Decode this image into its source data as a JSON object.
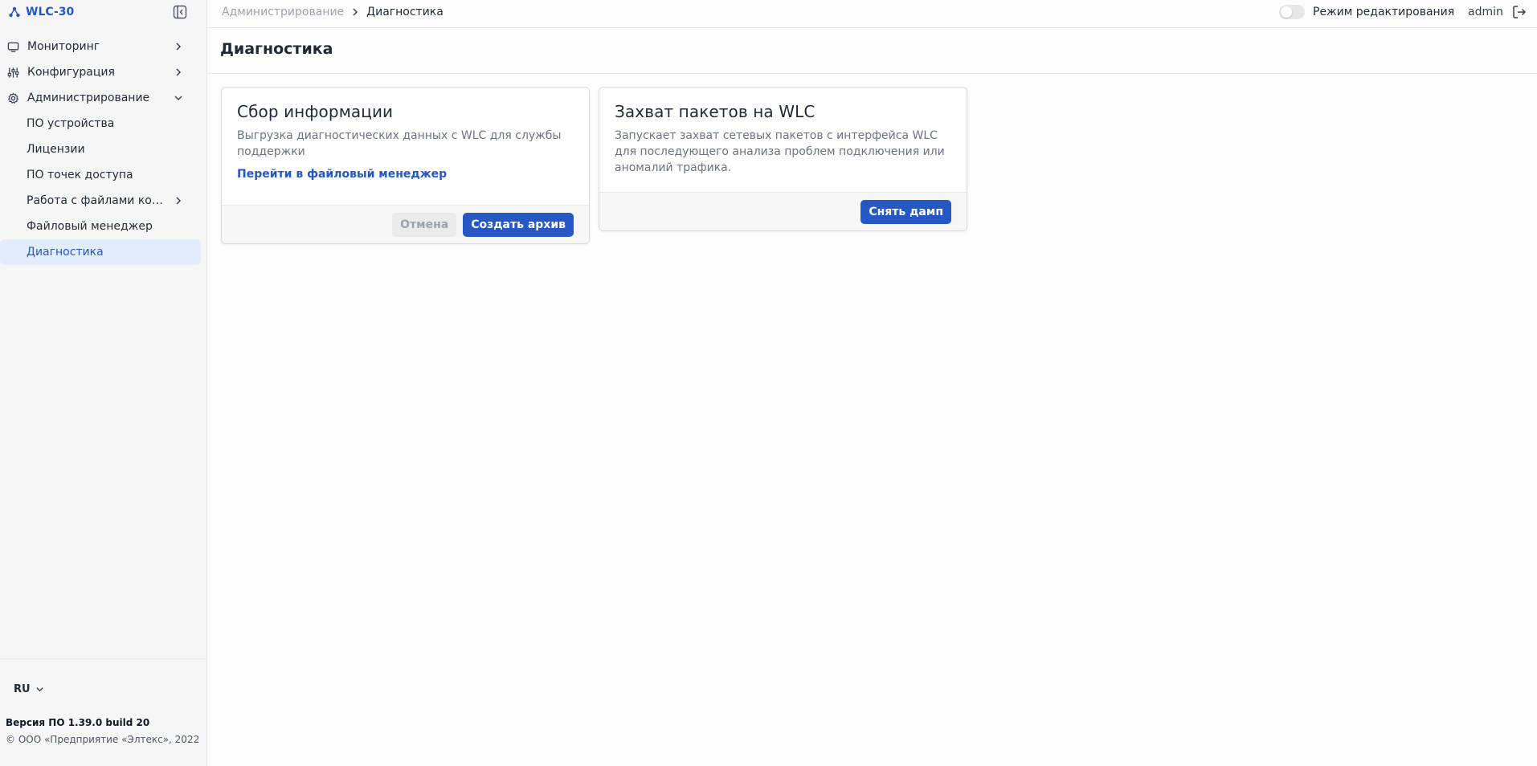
{
  "app": {
    "name": "WLC-30"
  },
  "sidebar": {
    "items": [
      {
        "label": "Мониторинг",
        "icon": "monitor-icon"
      },
      {
        "label": "Конфигурация",
        "icon": "sliders-icon"
      },
      {
        "label": "Администрирование",
        "icon": "gear-icon"
      }
    ],
    "admin_sub": [
      {
        "label": "ПО устройства"
      },
      {
        "label": "Лицензии"
      },
      {
        "label": "ПО точек доступа"
      },
      {
        "label": "Работа с файлами конф..."
      },
      {
        "label": "Файловый менеджер"
      },
      {
        "label": "Диагностика"
      }
    ],
    "language": "RU",
    "version": "Версия ПО 1.39.0 build 20",
    "copyright": "© ООО «Предприятие «Элтекс», 2022"
  },
  "topbar": {
    "breadcrumb_parent": "Администрирование",
    "breadcrumb_current": "Диагностика",
    "edit_mode_label": "Режим редактирования",
    "username": "admin"
  },
  "page": {
    "title": "Диагностика"
  },
  "cards": [
    {
      "title": "Сбор информации",
      "description": "Выгрузка диагностических данных с WLC для службы поддержки",
      "link": "Перейти в файловый менеджер",
      "cancel_label": "Отмена",
      "primary_label": "Создать архив"
    },
    {
      "title": "Захват пакетов на WLC",
      "description": "Запускает захват сетевых пакетов с интерфейса WLC для последующего анализа проблем подключения или аномалий трафика.",
      "primary_label": "Снять дамп"
    }
  ],
  "colors": {
    "accent": "#2557c5",
    "active_bg": "#e3ecfa"
  }
}
